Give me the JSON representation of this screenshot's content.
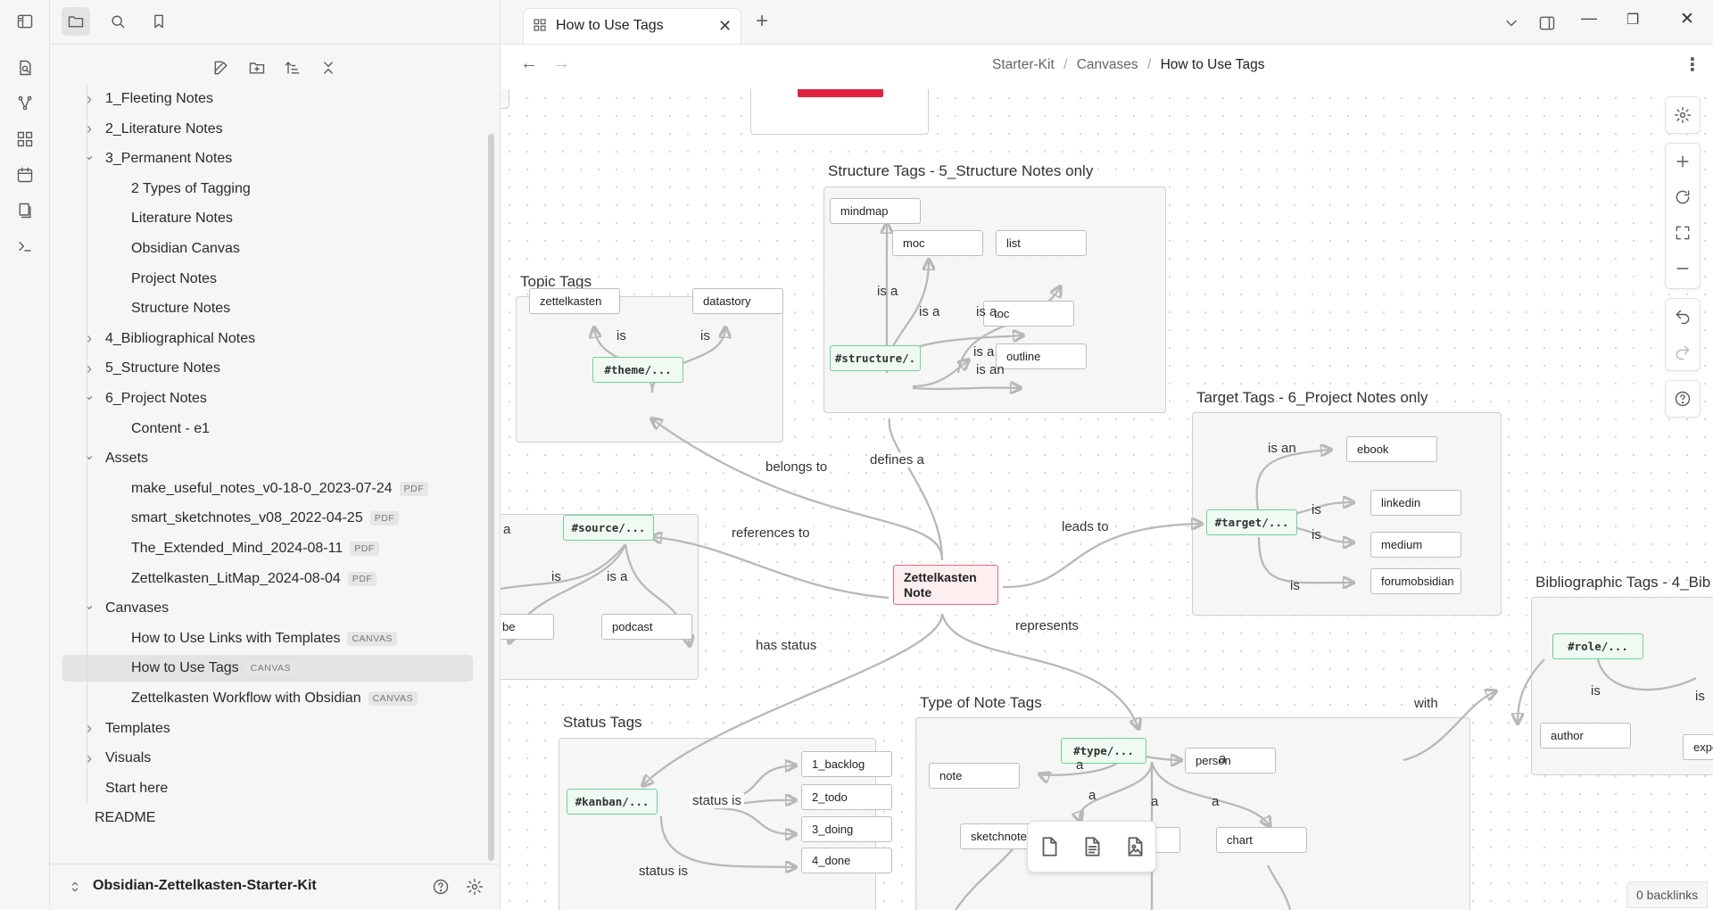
{
  "sidebar": {
    "tree": [
      {
        "label": "1_Fleeting Notes",
        "type": "folder",
        "expanded": false
      },
      {
        "label": "2_Literature Notes",
        "type": "folder",
        "expanded": false
      },
      {
        "label": "3_Permanent Notes",
        "type": "folder",
        "expanded": true
      },
      {
        "label": "2 Types of Tagging",
        "type": "file"
      },
      {
        "label": "Literature Notes",
        "type": "file"
      },
      {
        "label": "Obsidian Canvas",
        "type": "file"
      },
      {
        "label": "Project Notes",
        "type": "file"
      },
      {
        "label": "Structure Notes",
        "type": "file"
      },
      {
        "label": "4_Bibliographical Notes",
        "type": "folder",
        "expanded": false
      },
      {
        "label": "5_Structure Notes",
        "type": "folder",
        "expanded": false
      },
      {
        "label": "6_Project Notes",
        "type": "folder",
        "expanded": true
      },
      {
        "label": "Content - e1",
        "type": "file"
      },
      {
        "label": "Assets",
        "type": "folder",
        "expanded": true
      },
      {
        "label": "make_useful_notes_v0-18-0_2023-07-24",
        "type": "file",
        "badge": "PDF"
      },
      {
        "label": "smart_sketchnotes_v08_2022-04-25",
        "type": "file",
        "badge": "PDF"
      },
      {
        "label": "The_Extended_Mind_2024-08-11",
        "type": "file",
        "badge": "PDF"
      },
      {
        "label": "Zettelkasten_LitMap_2024-08-04",
        "type": "file",
        "badge": "PDF"
      },
      {
        "label": "Canvases",
        "type": "folder",
        "expanded": true
      },
      {
        "label": "How to Use Links with Templates",
        "type": "file",
        "badge": "CANVAS"
      },
      {
        "label": "How to Use Tags",
        "type": "file",
        "badge": "CANVAS",
        "selected": true
      },
      {
        "label": "Zettelkasten Workflow with Obsidian",
        "type": "file",
        "badge": "CANVAS"
      },
      {
        "label": "Templates",
        "type": "folder",
        "expanded": false
      },
      {
        "label": "Visuals",
        "type": "folder",
        "expanded": false
      },
      {
        "label": "Start here",
        "type": "file"
      },
      {
        "label": "README",
        "type": "file"
      }
    ],
    "vault_name": "Obsidian-Zettelkasten-Starter-Kit"
  },
  "tab": {
    "title": "How to Use Tags"
  },
  "breadcrumb": {
    "part1": "Starter-Kit",
    "part2": "Canvases",
    "current": "How to Use Tags",
    "sep": "/"
  },
  "status": {
    "backlinks": "0 backlinks"
  },
  "canvas": {
    "groups": {
      "structure": "Structure Tags - 5_Structure Notes only",
      "topic": "Topic Tags",
      "target": "Target Tags - 6_Project Notes only",
      "status": "Status Tags",
      "type": "Type of Note Tags",
      "biblio": "Bibliographic Tags - 4_Bib"
    },
    "nodes": {
      "mindmap": "mindmap",
      "moc": "moc",
      "list": "list",
      "toc": "toc",
      "outline": "outline",
      "structure_tag": "#structure/.",
      "zettelkasten": "zettelkasten",
      "datastory": "datastory",
      "theme_tag": "#theme/...",
      "source_tag": "#source/...",
      "be": "be",
      "podcast": "podcast",
      "center_line1": "Zettelkasten",
      "center_line2": "Note",
      "target_tag": "#target/...",
      "ebook": "ebook",
      "linkedin": "linkedin",
      "medium": "medium",
      "forumobsidian": "forumobsidian",
      "kanban_tag": "#kanban/...",
      "backlog": "1_backlog",
      "todo": "2_todo",
      "doing": "3_doing",
      "done": "4_done",
      "type_tag": "#type/...",
      "note": "note",
      "person": "person",
      "sketchnote": "sketchnote",
      "chart": "chart",
      "role_tag": "#role/...",
      "author": "author",
      "expe": "expe"
    },
    "edges": {
      "is_a": "is a",
      "is": "is",
      "is_an": "is an",
      "belongs_to": "belongs to",
      "defines_a": "defines a",
      "references_to": "references to",
      "leads_to": "leads to",
      "has_status": "has status",
      "represents": "represents",
      "status_is": "status is",
      "a": "a",
      "with": "with",
      "cut_a": "a"
    }
  }
}
